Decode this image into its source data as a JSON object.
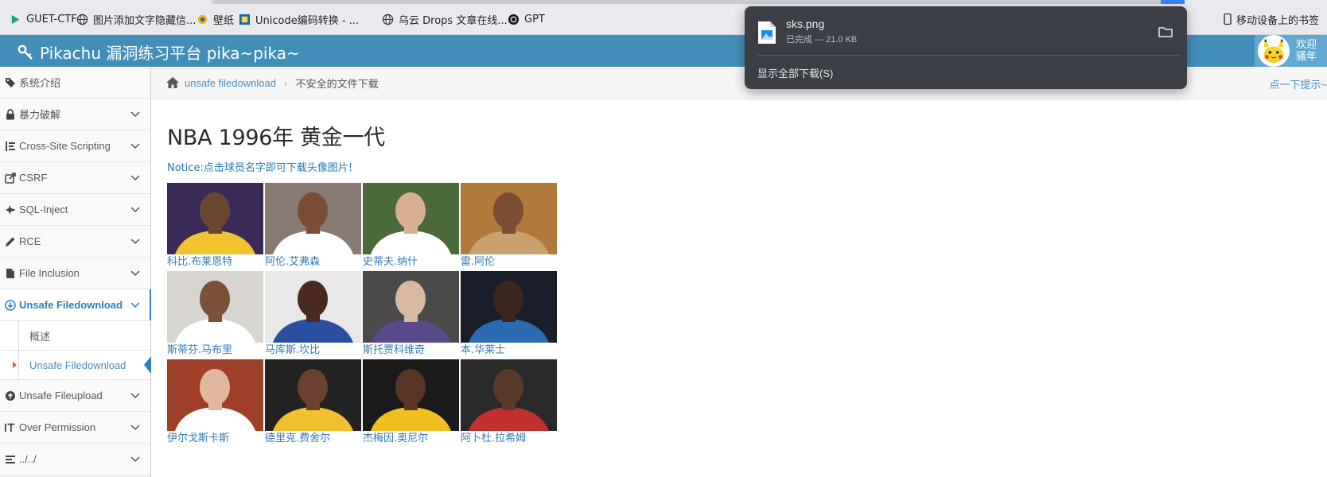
{
  "bookmarks": [
    {
      "label": "GUET-CTF",
      "icon": "guet-icon"
    },
    {
      "label": "图片添加文字隐藏信...",
      "icon": "globe-icon"
    },
    {
      "label": "壁纸",
      "icon": "wallpaper-icon"
    },
    {
      "label": "Unicode编码转换 - ...",
      "icon": "unicode-icon"
    },
    {
      "label": "乌云 Drops 文章在线...",
      "icon": "globe-icon"
    },
    {
      "label": "GPT",
      "icon": "openai-icon"
    }
  ],
  "bookmarks_mobile": "移动设备上的书签",
  "header": {
    "brand": "Pikachu 漏洞练习平台 pika~pika~",
    "brand_icon": "key-icon",
    "user_line1": "欢迎",
    "user_line2": "骚年",
    "colors": {
      "header": "#438eb9",
      "user_box": "#62a8d1"
    }
  },
  "sidebar": {
    "items": [
      {
        "label": "系统介绍",
        "icon": "tags-icon"
      },
      {
        "label": "暴力破解",
        "icon": "lock-icon"
      },
      {
        "label": "Cross-Site Scripting",
        "icon": "list-icon"
      },
      {
        "label": "CSRF",
        "icon": "external-link-icon"
      },
      {
        "label": "SQL-Inject",
        "icon": "fighter-jet-icon"
      },
      {
        "label": "RCE",
        "icon": "pencil-icon"
      },
      {
        "label": "File Inclusion",
        "icon": "file-icon"
      },
      {
        "label": "Unsafe Filedownload",
        "icon": "download-icon"
      },
      {
        "label": "Unsafe Fileupload",
        "icon": "upload-icon"
      },
      {
        "label": "Over Permission",
        "icon": "text-height-icon"
      },
      {
        "label": "../../",
        "icon": "align-left-icon"
      }
    ],
    "sub_items": [
      {
        "label": "概述"
      },
      {
        "label": "Unsafe Filedownload"
      }
    ]
  },
  "breadcrumb": {
    "icon": "home-icon",
    "link": "unsafe filedownload",
    "current": "不安全的文件下载",
    "hint": "点一下提示~"
  },
  "main": {
    "title": "NBA 1996年 黄金一代",
    "notice": "Notice:点击球员名字即可下载头像图片!",
    "players": [
      {
        "name": "科比.布莱恩特",
        "bg": "#3a2a5a",
        "jersey": "#f2c230",
        "skin": "#6b4530"
      },
      {
        "name": "阿伦.艾弗森",
        "bg": "#8a7a74",
        "jersey": "#ffffff",
        "skin": "#7a4e36"
      },
      {
        "name": "史蒂夫.纳什",
        "bg": "#4a6a3a",
        "jersey": "#ffffff",
        "skin": "#d8b090"
      },
      {
        "name": "雷.阿伦",
        "bg": "#b07a3a",
        "jersey": "#c9a070",
        "skin": "#7a4e34"
      },
      {
        "name": "斯蒂芬.马布里",
        "bg": "#d8d4cf",
        "jersey": "#ffffff",
        "skin": "#7a5038"
      },
      {
        "name": "马库斯.坎比",
        "bg": "#e8e8e8",
        "jersey": "#2a4fa0",
        "skin": "#4a2a1e"
      },
      {
        "name": "斯托贾科维奇",
        "bg": "#4a4a4a",
        "jersey": "#5a4a8a",
        "skin": "#d8b8a0"
      },
      {
        "name": "本.华莱士",
        "bg": "#1a1e2a",
        "jersey": "#2a6ab0",
        "skin": "#3a261e"
      },
      {
        "name": "伊尔戈斯卡斯",
        "bg": "#a04028",
        "jersey": "#ffffff",
        "skin": "#e0b8a0"
      },
      {
        "name": "德里克.费舍尔",
        "bg": "#222222",
        "jersey": "#f0c030",
        "skin": "#6a4030"
      },
      {
        "name": "杰梅因.奥尼尔",
        "bg": "#1a1a1a",
        "jersey": "#f0c020",
        "skin": "#5a3424"
      },
      {
        "name": "阿卜杜.拉希姆",
        "bg": "#2a2a2a",
        "jersey": "#c03030",
        "skin": "#5a3a2a"
      }
    ]
  },
  "download": {
    "filename": "sks.png",
    "status": "已完成 — 21.0 KB",
    "show_all": "显示全部下载(S)"
  }
}
